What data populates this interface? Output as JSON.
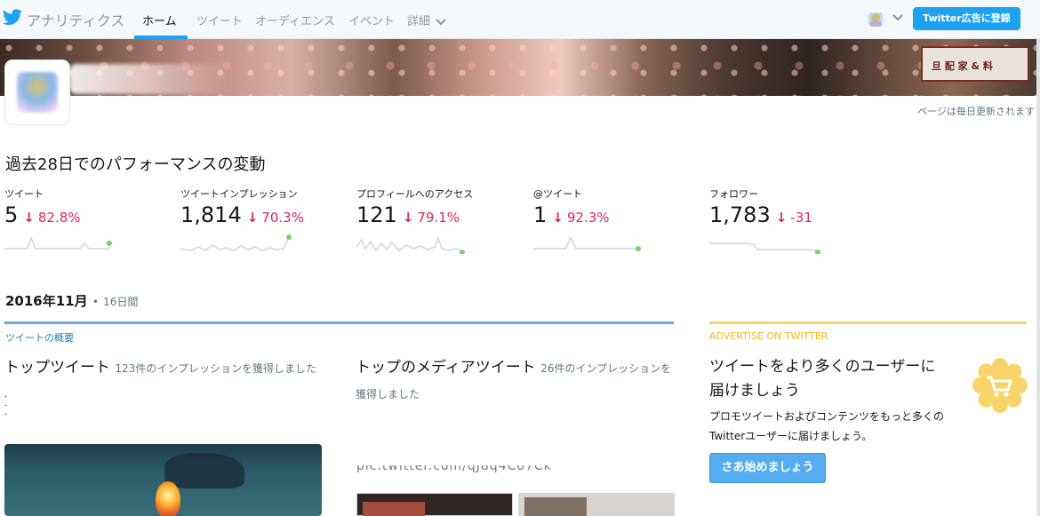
{
  "nav": {
    "brand": "アナリティクス",
    "items": [
      "ホーム",
      "ツイート",
      "オーディエンス",
      "イベント",
      "詳細"
    ],
    "ads_button": "Twitter広告に登録"
  },
  "profile": {
    "update_note": "ページは毎日更新されます"
  },
  "performance": {
    "title": "過去28日でのパフォーマンスの変動",
    "stats": [
      {
        "label": "ツイート",
        "value": "5",
        "change": "82.8%",
        "direction": "down"
      },
      {
        "label": "ツイートインプレッション",
        "value": "1,814",
        "change": "70.3%",
        "direction": "down"
      },
      {
        "label": "プロフィールへのアクセス",
        "value": "121",
        "change": "79.1%",
        "direction": "down"
      },
      {
        "label": "@ツイート",
        "value": "1",
        "change": "92.3%",
        "direction": "down"
      },
      {
        "label": "フォロワー",
        "value": "1,783",
        "change": "-31",
        "direction": "down"
      }
    ]
  },
  "month": {
    "title": "2016年11月",
    "separator": "•",
    "days": "16日間"
  },
  "overview": {
    "section_label": "ツイートの概要",
    "top_tweet": {
      "title": "トップツイート",
      "sub": "123件のインプレッションを獲得しました"
    },
    "top_media": {
      "title": "トップのメディアツイート",
      "sub": "26件のインプレッションを獲得しました"
    }
  },
  "ad": {
    "section_label": "ADVERTISE ON TWITTER",
    "headline": "ツイートをより多くのユーザーに届けましょう",
    "body": "プロモツイートおよびコンテンツをもっと多くのTwitterユーザーに届けましょう。",
    "button": "さあ始めましょう"
  },
  "colors": {
    "accent": "#1da1f2",
    "negative": "#e0245e",
    "sparkline": "#ccd6dd",
    "sparkline_end": "#7fcf6a",
    "ad_yellow": "#f7d46a"
  },
  "icons": [
    "twitter-bird-icon",
    "chevron-down-icon",
    "arrow-down-icon",
    "shopping-cart-icon"
  ]
}
